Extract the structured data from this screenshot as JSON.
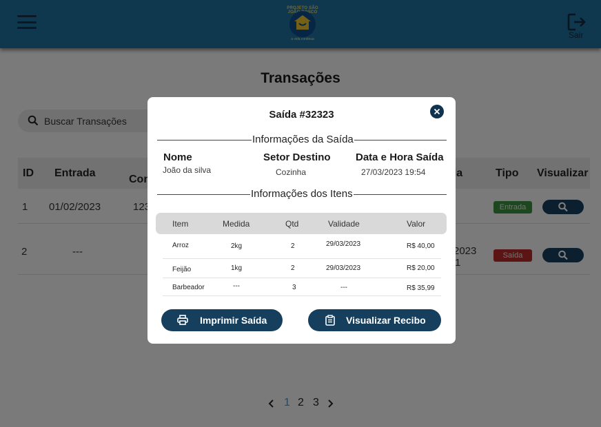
{
  "header": {
    "logo_arc_text": "PROJETO SÃO JOÃO BOSCO",
    "logo_tagline": "a vida continua",
    "logout_label": "Sair"
  },
  "page": {
    "title": "Transações",
    "search_placeholder": "Buscar Transações"
  },
  "table": {
    "headers": {
      "id": "ID",
      "entrada": "Entrada",
      "col3": "Con",
      "saida": "ída",
      "tipo": "Tipo",
      "visualizar": "Visualizar"
    },
    "rows": [
      {
        "id": "1",
        "entrada": "01/02/2023",
        "col3": "123",
        "saida": "",
        "tipo": "Entrada",
        "tipo_color": "#3a8e3f"
      },
      {
        "id": "2",
        "entrada": "---",
        "col3": "",
        "saida": "2023",
        "saida_line2": "1",
        "tipo": "Saída",
        "tipo_color": "#b92b2b"
      }
    ]
  },
  "pagination": {
    "pages": [
      "1",
      "2",
      "3"
    ],
    "current_page": "1",
    "current_color": "#5b8fb5"
  },
  "modal": {
    "title": "Saída #32323",
    "info_section": "Informações da Saída",
    "nome_label": "Nome",
    "nome_value": "João da silva",
    "setor_label": "Setor Destino",
    "setor_value": "Cozinha",
    "data_label": "Data e Hora Saída",
    "data_value": "27/03/2023 19:54",
    "items_section": "Informações dos Itens",
    "items_headers": {
      "item": "Item",
      "medida": "Medida",
      "qtd": "Qtd",
      "validade": "Validade",
      "valor": "Valor"
    },
    "items": [
      {
        "item": "Arroz",
        "medida": "2kg",
        "qtd": "2",
        "validade": "29/03/2023",
        "valor": "R$ 40,00"
      },
      {
        "item": "Feijão",
        "medida": "1kg",
        "qtd": "2",
        "validade": "29/03/2023",
        "valor": "R$ 20,00"
      },
      {
        "item": "Barbeador",
        "medida": "---",
        "qtd": "3",
        "validade": "---",
        "valor": "R$ 35,99"
      }
    ],
    "print_button": "Imprimir Saída",
    "receipt_button": "Visualizar Recibo"
  },
  "colors": {
    "header_bg": "#1f6e9c",
    "accent_dark": "#163f5e",
    "badge_entrada": "#3a8e3f",
    "badge_saida": "#b92b2b"
  }
}
